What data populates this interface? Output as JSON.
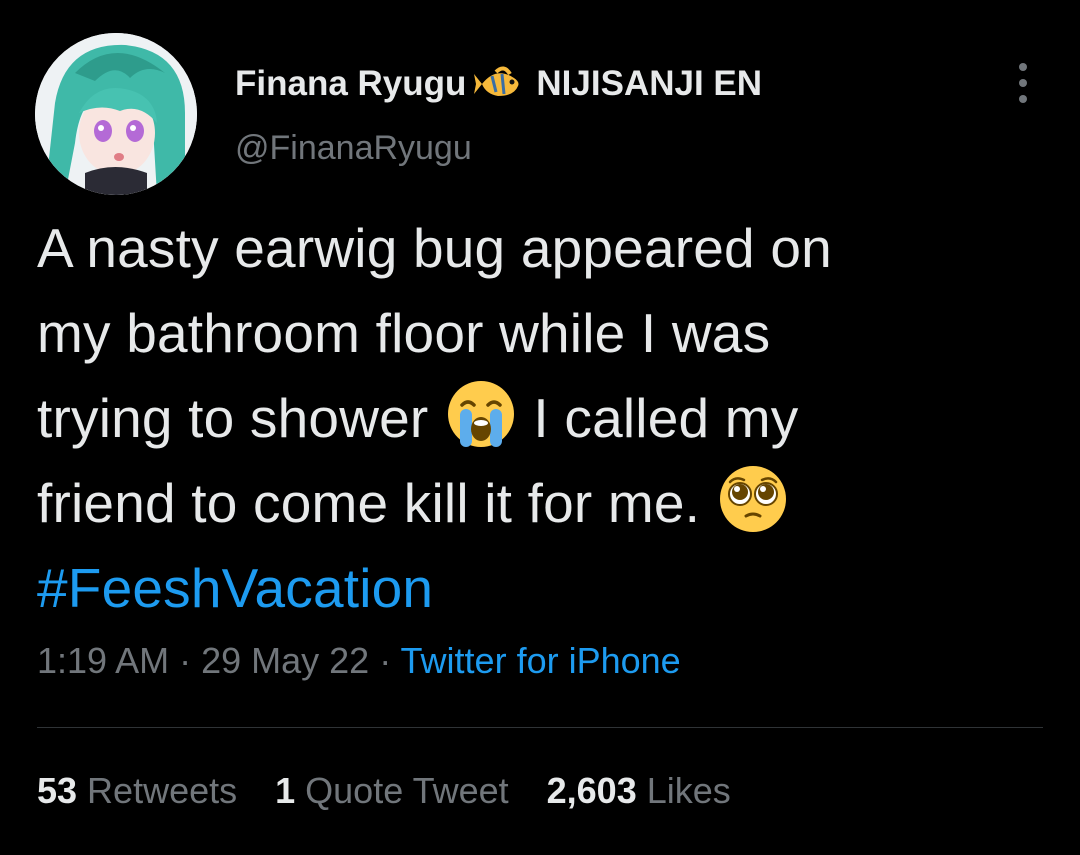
{
  "author": {
    "display_name": "Finana Ryugu",
    "affiliation": "NIJISANJI EN",
    "handle": "@FinanaRyugu",
    "badge_icon": "fish-icon"
  },
  "tweet": {
    "lines": [
      "A nasty earwig bug appeared on",
      "my bathroom floor while I was",
      "trying to shower",
      "I called my",
      "friend to come kill it for me."
    ],
    "emoji_crying": "loudly-crying-face-emoji",
    "emoji_pleading": "pleading-face-emoji",
    "hashtag": "#FeeshVacation"
  },
  "meta": {
    "time": "1:19 AM",
    "separator": " · ",
    "date": "29 May 22",
    "source": "Twitter for iPhone"
  },
  "stats": {
    "retweets_count": "53",
    "retweets_label": "Retweets",
    "quotes_count": "1",
    "quotes_label": "Quote Tweet",
    "likes_count": "2,603",
    "likes_label": "Likes"
  },
  "colors": {
    "background": "#000000",
    "text": "#e7e9ea",
    "secondary": "#71767b",
    "link": "#1d9bf0",
    "divider": "#2f3336"
  }
}
